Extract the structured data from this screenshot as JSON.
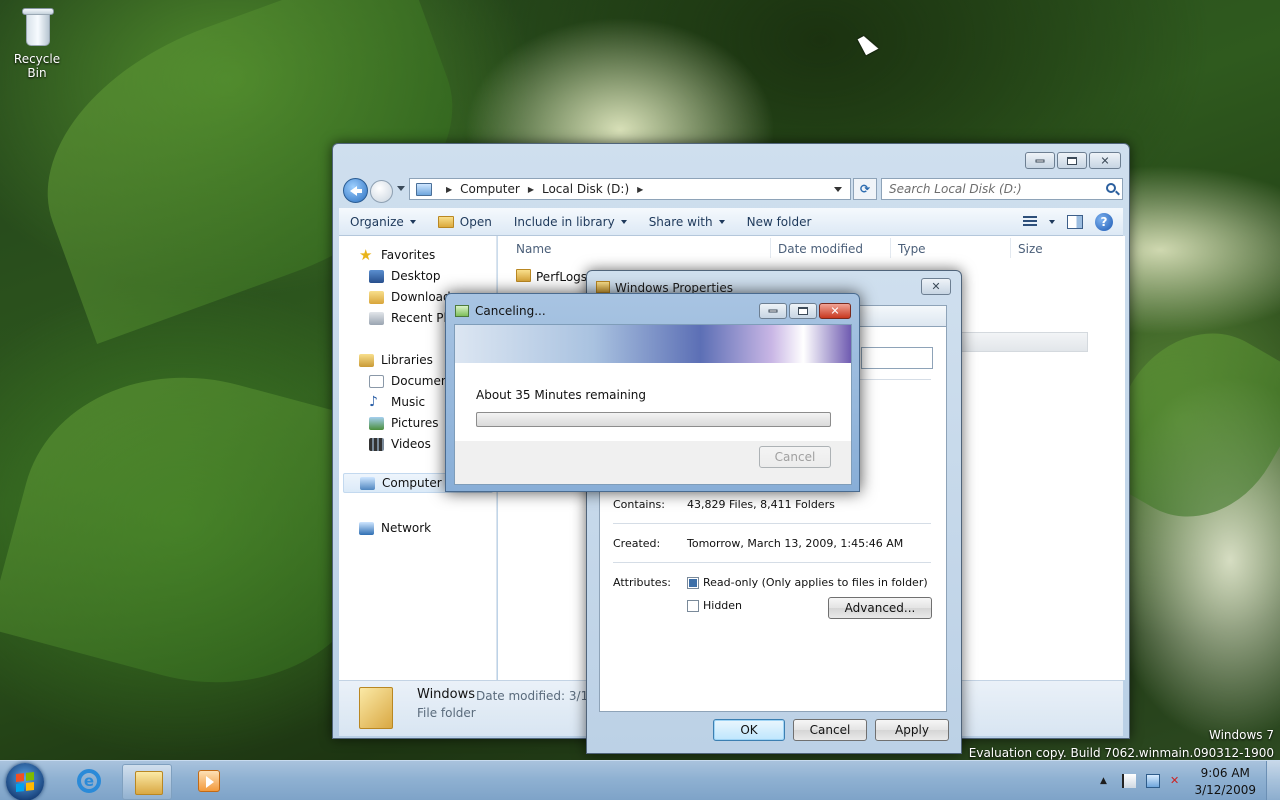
{
  "desktop": {
    "recycle_bin_label": "Recycle Bin",
    "watermark_line1": "Windows 7",
    "watermark_line2": "Evaluation copy. Build 7062.winmain.090312-1900"
  },
  "explorer": {
    "breadcrumb": [
      "Computer",
      "Local Disk (D:)"
    ],
    "search_placeholder": "Search Local Disk (D:)",
    "commands": {
      "organize": "Organize",
      "open": "Open",
      "include_in_library": "Include in library",
      "share_with": "Share with",
      "new_folder": "New folder"
    },
    "nav": {
      "favorites": "Favorites",
      "desktop": "Desktop",
      "downloads": "Downloads",
      "recent_places": "Recent Places",
      "libraries": "Libraries",
      "documents": "Documents",
      "music": "Music",
      "pictures": "Pictures",
      "videos": "Videos",
      "computer": "Computer",
      "network": "Network"
    },
    "columns": [
      "Name",
      "Date modified",
      "Type",
      "Size"
    ],
    "rows": [
      {
        "name": "PerfLogs"
      }
    ],
    "details": {
      "name": "Windows",
      "date_modified_label": "Date modified: 3/12/",
      "type": "File folder"
    }
  },
  "properties": {
    "title": "Windows Properties",
    "contains_label": "Contains:",
    "contains_value": "43,829 Files, 8,411 Folders",
    "created_label": "Created:",
    "created_value": "Tomorrow, March 13, 2009, 1:45:46 AM",
    "attributes_label": "Attributes:",
    "readonly_label": "Read-only (Only applies to files in folder)",
    "readonly_checked": true,
    "hidden_label": "Hidden",
    "hidden_checked": false,
    "advanced_button": "Advanced...",
    "ok_button": "OK",
    "cancel_button": "Cancel",
    "apply_button": "Apply"
  },
  "canceling": {
    "title": "Canceling...",
    "remaining_text": "About 35 Minutes remaining",
    "progress_fraction": 0.0,
    "cancel_button": "Cancel"
  },
  "taskbar": {
    "time": "9:06 AM",
    "date": "3/12/2009",
    "pinned": [
      "internet-explorer-icon",
      "windows-explorer-icon",
      "windows-media-player-icon"
    ]
  }
}
